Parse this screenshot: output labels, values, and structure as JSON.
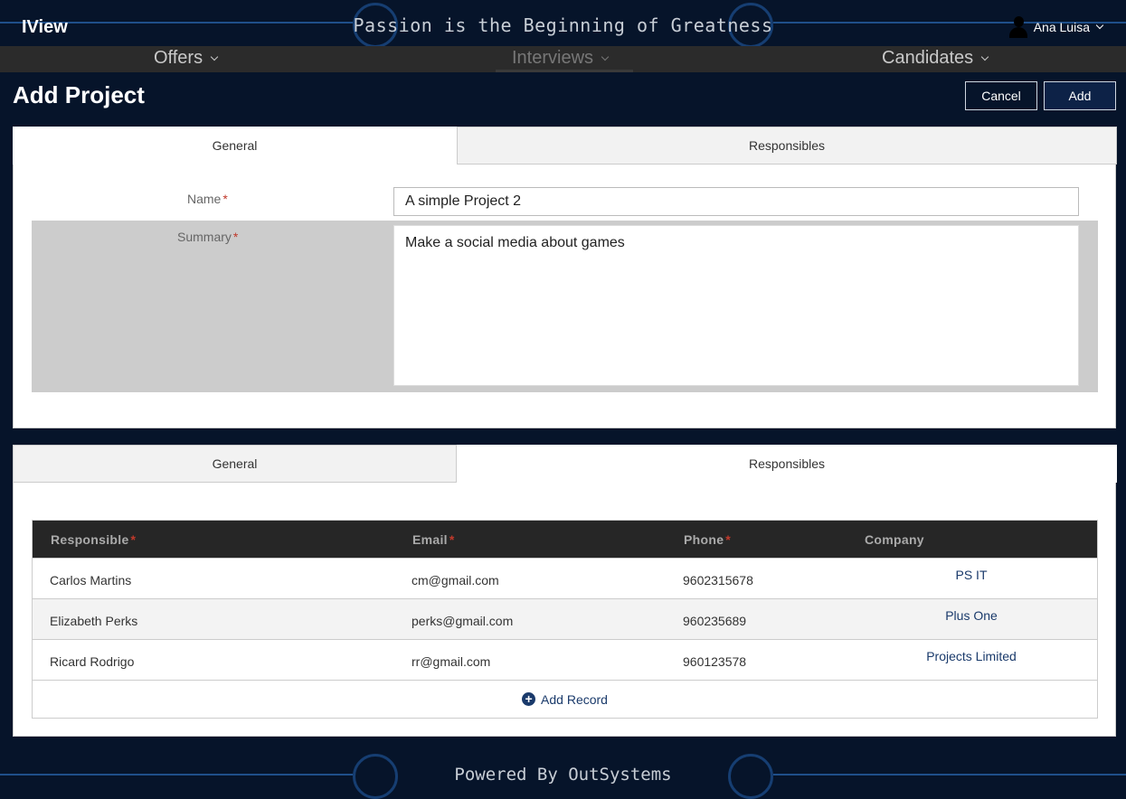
{
  "header": {
    "app_title": "IView",
    "tagline": "Passion is the Beginning of Greatness",
    "user_name": "Ana Luisa"
  },
  "nav": {
    "items": [
      {
        "label": "Offers"
      },
      {
        "label": "Interviews"
      },
      {
        "label": "Candidates"
      }
    ],
    "active": "Interviews"
  },
  "page": {
    "title": "Add Project",
    "cancel_label": "Cancel",
    "add_label": "Add"
  },
  "panel1": {
    "tabs": [
      {
        "label": "General"
      },
      {
        "label": "Responsibles"
      }
    ],
    "active_tab": "General",
    "name_label": "Name",
    "name_value": "A simple Project 2",
    "summary_label": "Summary",
    "summary_value": "Make a social media about games",
    "required_mark": "*"
  },
  "panel2": {
    "tabs": [
      {
        "label": "General"
      },
      {
        "label": "Responsibles"
      }
    ],
    "active_tab": "Responsibles",
    "columns": [
      "Responsible",
      "Email",
      "Phone",
      "Company"
    ],
    "rows": [
      {
        "responsible": "Carlos Martins",
        "email": "cm@gmail.com",
        "phone": "9602315678",
        "company": "PS IT"
      },
      {
        "responsible": "Elizabeth Perks",
        "email": "perks@gmail.com",
        "phone": "960235689",
        "company": "Plus One"
      },
      {
        "responsible": "Ricard Rodrigo",
        "email": "rr@gmail.com",
        "phone": "960123578",
        "company": "Projects Limited"
      }
    ],
    "add_record_label": "Add Record"
  },
  "footer": {
    "text": "Powered By OutSystems"
  },
  "colors": {
    "background": "#06142a",
    "nav": "#2b2b2b",
    "accent": "#1a3a6b",
    "required": "#c0392b"
  }
}
